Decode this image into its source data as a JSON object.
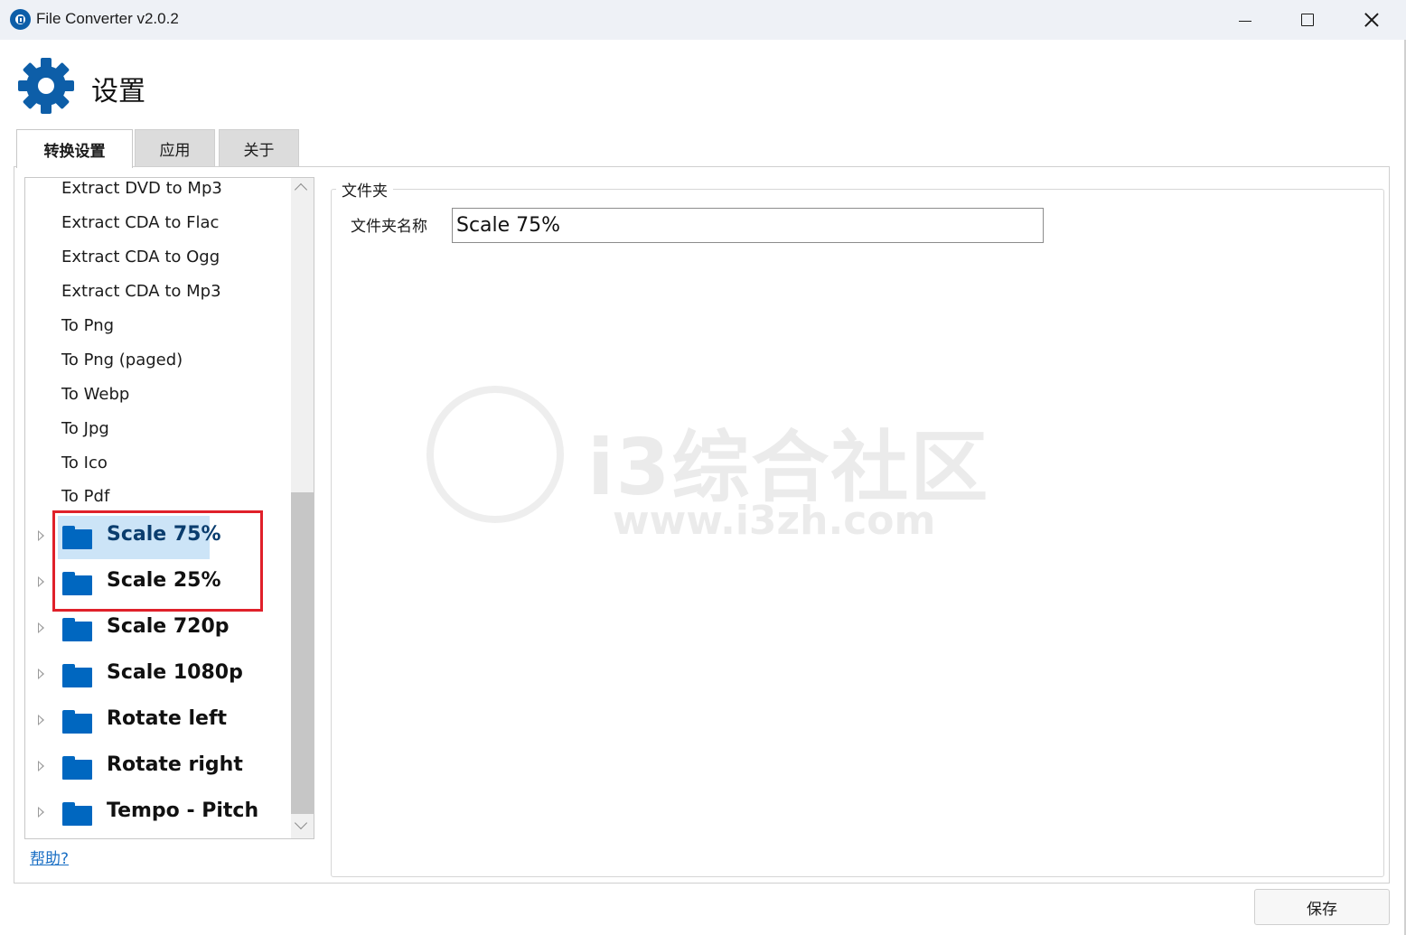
{
  "window": {
    "title": "File Converter v2.0.2"
  },
  "header": {
    "title": "设置"
  },
  "tabs": [
    {
      "label": "转换设置",
      "active": true
    },
    {
      "label": "应用",
      "active": false
    },
    {
      "label": "关于",
      "active": false
    }
  ],
  "tree": {
    "plain_items": [
      "Extract DVD to Mp3",
      "Extract CDA to Flac",
      "Extract CDA to Ogg",
      "Extract CDA to Mp3",
      "To Png",
      "To Png (paged)",
      "To Webp",
      "To Jpg",
      "To Ico",
      "To Pdf"
    ],
    "folders": [
      {
        "label": "Scale 75%",
        "selected": true
      },
      {
        "label": "Scale 25%",
        "selected": false
      },
      {
        "label": "Scale 720p",
        "selected": false
      },
      {
        "label": "Scale 1080p",
        "selected": false
      },
      {
        "label": "Rotate left",
        "selected": false
      },
      {
        "label": "Rotate right",
        "selected": false
      },
      {
        "label": "Tempo - Pitch",
        "selected": false
      }
    ]
  },
  "help_link": "帮助?",
  "folder_group": {
    "legend": "文件夹",
    "name_label": "文件夹名称",
    "name_value": "Scale 75%"
  },
  "footer": {
    "save_label": "保存"
  },
  "watermark": {
    "text": "i3综合社区",
    "url": "www.i3zh.com"
  },
  "colors": {
    "accent": "#0067c0",
    "selection": "#cce4f7",
    "highlight_box": "#e0202a",
    "link": "#1a6fc4"
  }
}
